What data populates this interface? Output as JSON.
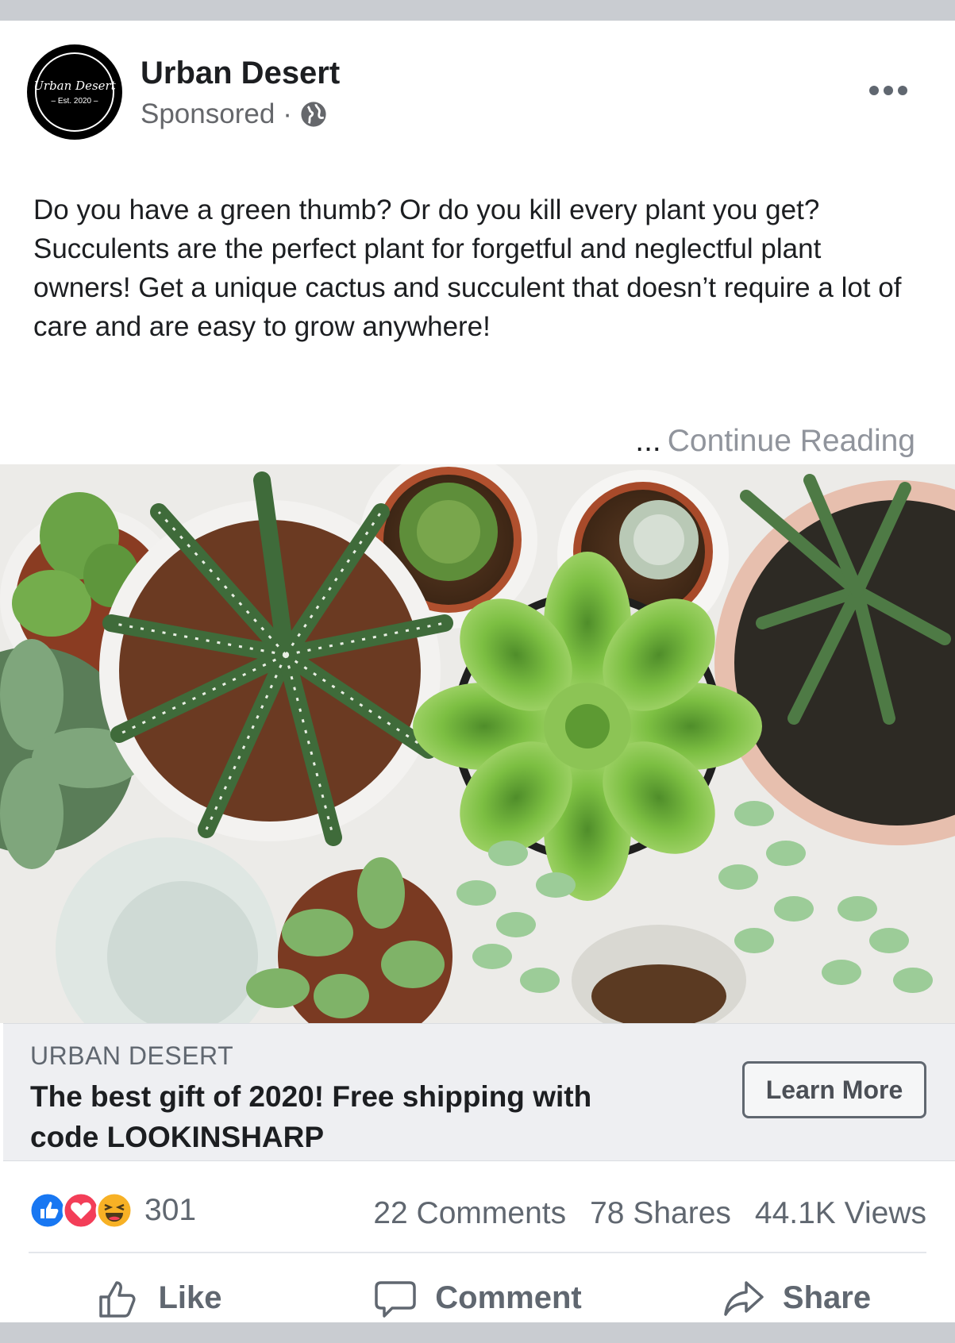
{
  "post": {
    "page_name": "Urban Desert",
    "sponsored_label": "Sponsored",
    "separator": "·",
    "avatar_logo_text": "Urban Desert",
    "avatar_logo_sub": "– Est. 2020 –",
    "body": "Do you have a green thumb? Or do you kill every plant you get? Succulents are the perfect plant for forgetful and neglectful plant owners! Get a unique cactus and succulent that doesn’t require a lot of care and are easy to grow anywhere!",
    "continue_ellipsis": "...",
    "continue_label": "Continue Reading"
  },
  "link_preview": {
    "domain": "URBAN DESERT",
    "headline": "The best gift of 2020! Free shipping with code LOOKINSHARP",
    "cta_label": "Learn More"
  },
  "stats": {
    "reaction_count": "301",
    "comments": "22 Comments",
    "shares": "78 Shares",
    "views": "44.1K Views",
    "reaction_icons": [
      "like-icon",
      "love-icon",
      "haha-icon"
    ]
  },
  "actions": {
    "like": "Like",
    "comment": "Comment",
    "share": "Share"
  },
  "colors": {
    "like_blue": "#1877f2",
    "love_red": "#f33e58",
    "haha_yellow": "#f7b125",
    "secondary_text": "#65676b"
  }
}
